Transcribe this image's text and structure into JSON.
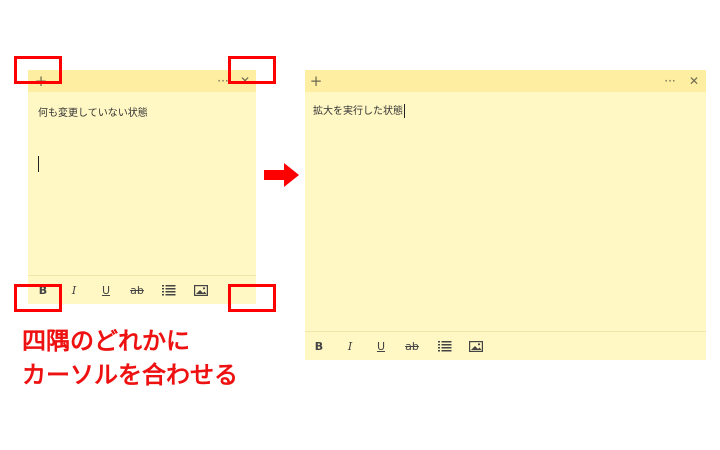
{
  "left_note": {
    "text": "何も変更していない状態",
    "add_label": "+",
    "more_label": "···",
    "close_label": "✕",
    "toolbar": {
      "bold": "B",
      "italic": "I",
      "underline": "U",
      "strike": "ab"
    }
  },
  "right_note": {
    "text": "拡大を実行した状態",
    "add_label": "+",
    "more_label": "···",
    "close_label": "✕",
    "toolbar": {
      "bold": "B",
      "italic": "I",
      "underline": "U",
      "strike": "ab"
    }
  },
  "caption": {
    "line1": "四隅のどれかに",
    "line2": "カーソルを合わせる"
  },
  "colors": {
    "note_body": "#fff7c4",
    "note_titlebar": "#fdeea1",
    "highlight": "#ff0000"
  }
}
